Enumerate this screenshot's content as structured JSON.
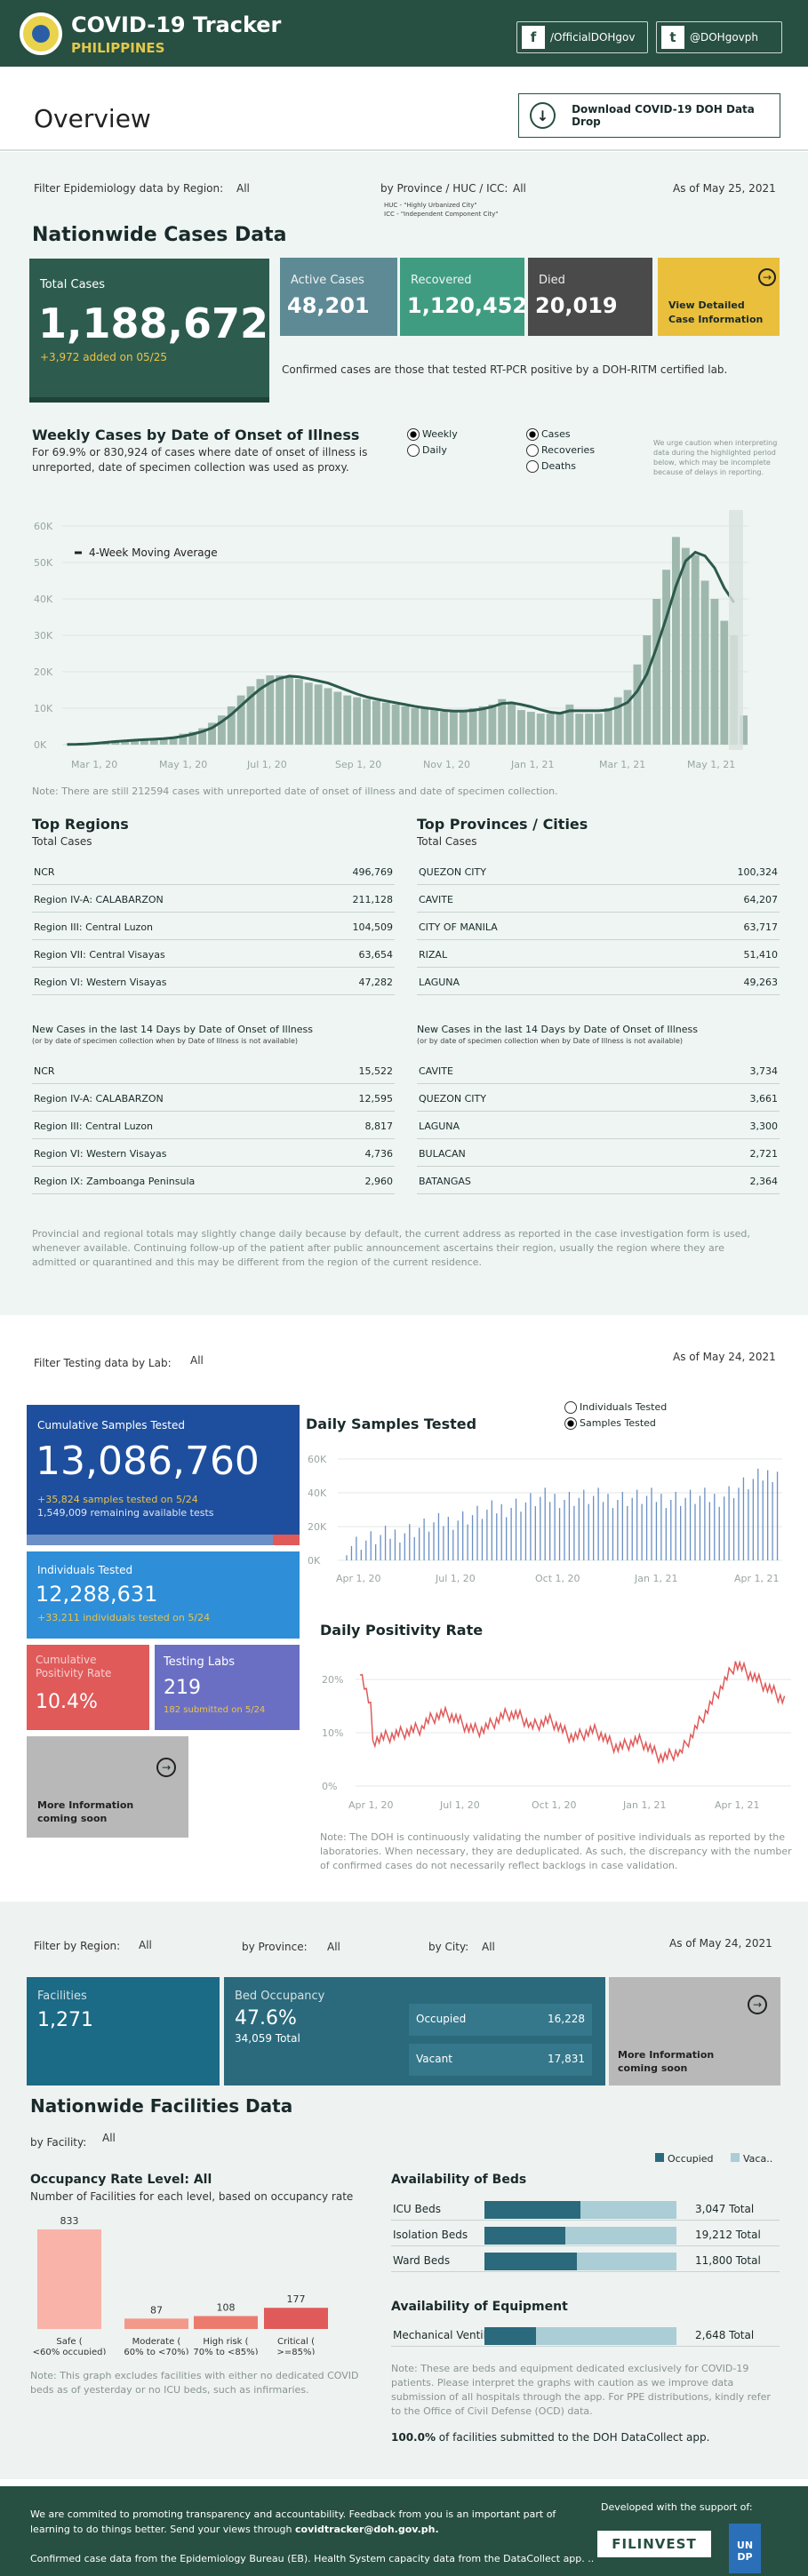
{
  "header": {
    "title": "COVID-19 Tracker",
    "subtitle": "PHILIPPINES",
    "facebook": "/OfficialDOHgov",
    "twitter": "@DOHgovph"
  },
  "overview": {
    "title": "Overview",
    "download_label": "Download COVID-19 DOH Data Drop"
  },
  "cases": {
    "filter_region_label": "Filter Epidemiology data by Region:",
    "filter_region_value": "All",
    "filter_province_label": "by Province / HUC / ICC:",
    "filter_province_value": "All",
    "huc_note": "HUC - \"Highly Urbanized City\"",
    "icc_note": "ICC - \"Independent Component City\"",
    "as_of": "As of May 25, 2021",
    "title": "Nationwide Cases Data",
    "total_label": "Total Cases",
    "total_value": "1,188,672",
    "total_added": "+3,972 added on 05/25",
    "active_label": "Active Cases",
    "active_value": "48,201",
    "recovered_label": "Recovered",
    "recovered_value": "1,120,452",
    "died_label": "Died",
    "died_value": "20,019",
    "view_detailed": "View Detailed Case Information",
    "confirmed_note": "Confirmed cases are those that tested RT-PCR positive by a DOH-RITM certified lab.",
    "weekly_title": "Weekly Cases by Date of Onset of Illness",
    "weekly_desc": "For 69.9% or 830,924 of cases where date of onset of illness is unreported, date of specimen collection was used as proxy.",
    "opt_weekly": "Weekly",
    "opt_daily": "Daily",
    "opt_cases": "Cases",
    "opt_recoveries": "Recoveries",
    "opt_deaths": "Deaths",
    "caution": "We urge caution when interpreting data during the highlighted period below, which may be incomplete because of delays in reporting.",
    "moving_avg": "4-Week Moving Average",
    "unreported_note": "Note: There are still 212594 cases with unreported date of onset of illness and date of specimen collection.",
    "top_regions": "Top Regions",
    "top_regions_sub": "Total Cases",
    "top_prov": "Top Provinces / Cities",
    "top_prov_sub": "Total Cases",
    "regions": [
      [
        "NCR",
        "496,769"
      ],
      [
        "Region IV-A: CALABARZON",
        "211,128"
      ],
      [
        "Region III: Central Luzon",
        "104,509"
      ],
      [
        "Region VII: Central Visayas",
        "63,654"
      ],
      [
        "Region VI: Western Visayas",
        "47,282"
      ]
    ],
    "provinces": [
      [
        "QUEZON CITY",
        "100,324"
      ],
      [
        "CAVITE",
        "64,207"
      ],
      [
        "CITY OF MANILA",
        "63,717"
      ],
      [
        "RIZAL",
        "51,410"
      ],
      [
        "LAGUNA",
        "49,263"
      ]
    ],
    "new14_title": "New Cases in the last 14 Days by Date of Onset of Illness",
    "new14_sub": "(or by date of specimen collection when by Date of Illness is not available)",
    "regions14": [
      [
        "NCR",
        "15,522"
      ],
      [
        "Region IV-A: CALABARZON",
        "12,595"
      ],
      [
        "Region III: Central Luzon",
        "8,817"
      ],
      [
        "Region VI: Western Visayas",
        "4,736"
      ],
      [
        "Region IX: Zamboanga Peninsula",
        "2,960"
      ]
    ],
    "provinces14": [
      [
        "CAVITE",
        "3,734"
      ],
      [
        "QUEZON CITY",
        "3,661"
      ],
      [
        "LAGUNA",
        "3,300"
      ],
      [
        "BULACAN",
        "2,721"
      ],
      [
        "BATANGAS",
        "2,364"
      ]
    ],
    "provincial_note": "Provincial and regional totals may slightly change daily because by default, the current address as reported in the case investigation form is used, whenever available. Continuing follow-up of the patient after public announcement ascertains their region, usually the region where they are admitted or quarantined and this may be different from the region of the current residence."
  },
  "testing": {
    "filter_label": "Filter Testing data by Lab:",
    "filter_value": "All",
    "as_of": "As of May 24, 2021",
    "cumulative_label": "Cumulative Samples Tested",
    "cumulative_value": "13,086,760",
    "cumulative_added": "+35,824 samples tested on 5/24",
    "cumulative_remaining": "1,549,009 remaining available tests",
    "individuals_label": "Individuals Tested",
    "individuals_value": "12,288,631",
    "individuals_added": "+33,211  individuals  tested on 5/24",
    "positivity_label": "Cumulative Positivity Rate",
    "positivity_value": "10.4%",
    "labs_label": "Testing Labs",
    "labs_value": "219",
    "labs_sub": "182 submitted on 5/24",
    "more_info": "More Information coming soon",
    "daily_title": "Daily Samples Tested",
    "opt_individuals": "Individuals Tested",
    "opt_samples": "Samples Tested",
    "positivity_title": "Daily Positivity Rate",
    "note": "Note: The DOH is continuously validating the number of positive individuals as reported by the laboratories. When necessary, they are deduplicated. As such, the discrepancy with the number of confirmed cases do not necessarily reflect backlogs in case validation."
  },
  "facilities": {
    "filter_region_label": "Filter by Region:",
    "filter_region_value": "All",
    "filter_province_label": "by Province:",
    "filter_province_value": "All",
    "filter_city_label": "by City:",
    "filter_city_value": "All",
    "as_of": "As of May 24, 2021",
    "facilities_label": "Facilities",
    "facilities_value": "1,271",
    "bed_label": "Bed Occupancy",
    "bed_value": "47.6%",
    "bed_total": "34,059 Total",
    "occupied_label": "Occupied",
    "occupied_value": "16,228",
    "vacant_label": "Vacant",
    "vacant_value": "17,831",
    "more_info": "More Information coming soon",
    "title": "Nationwide Facilities Data",
    "by_facility_label": "by Facility:",
    "by_facility_value": "All",
    "legend_occupied": "Occupied",
    "legend_vacant": "Vaca..",
    "occ_title": "Occupancy Rate Level:",
    "occ_title_value": "All",
    "occ_sub": "Number of Facilities for each level, based on occupancy rate",
    "occ_note": "Note: This graph excludes facilities with either no dedicated COVID beds as of yesterday or no ICU beds, such as infirmaries.",
    "beds_title": "Availability of Beds",
    "beds": [
      {
        "label": "ICU Beds",
        "total": "3,047 Total",
        "occ": 0.5
      },
      {
        "label": "Isolation Beds",
        "total": "19,212 Total",
        "occ": 0.42
      },
      {
        "label": "Ward Beds",
        "total": "11,800 Total",
        "occ": 0.48
      }
    ],
    "equip_title": "Availability of Equipment",
    "equip": [
      {
        "label": "Mechanical Ventilators",
        "total": "2,648 Total",
        "occ": 0.27
      }
    ],
    "beds_note": "Note: These are beds and equipment dedicated exclusively for COVID-19 patients. Please interpret the graphs with caution as we improve data submission of all hospitals through the app. For PPE distributions, kindly refer to the Office of Civil Defense (OCD) data.",
    "submitted": "100.0%",
    "submitted_rest": " of facilities submitted to the DOH DataCollect app."
  },
  "footer": {
    "text1": "We are commited to promoting transparency and accountability. Feedback from you is an important part of learning to do things better. Send your views through ",
    "email": "covidtracker@doh.gov.ph.",
    "support": "Developed with the support of:",
    "filinvest": "FILINVEST",
    "undp": "UN DP",
    "text2": "Confirmed case data from the Epidemiology Bureau (EB). Health System capacity data from the DataCollect app. .."
  },
  "colors": {
    "dark_green": "#274f42",
    "total_card": "#2d5c4f",
    "active": "#5e8a95",
    "recovered": "#3f9c80",
    "died": "#4a4a4a",
    "yellow": "#e9bf3c",
    "blue_dark": "#1e4f9e",
    "blue_mid": "#2e8ed8",
    "red": "#e05a5a",
    "purple": "#6b6fc4",
    "teal": "#1b6a86",
    "grey": "#b8b8b8"
  },
  "chart_data": [
    {
      "type": "bar",
      "title": "Weekly Cases by Date of Onset of Illness",
      "x_ticks": [
        "Mar 1, 20",
        "May 1, 20",
        "Jul 1, 20",
        "Sep 1, 20",
        "Nov 1, 20",
        "Jan 1, 21",
        "Mar 1, 21",
        "May 1, 21"
      ],
      "y_ticks": [
        "0K",
        "10K",
        "20K",
        "30K",
        "40K",
        "50K",
        "60K"
      ],
      "ylim": [
        0,
        60000
      ],
      "values": [
        50,
        100,
        200,
        400,
        700,
        1000,
        1200,
        1300,
        1400,
        1600,
        1800,
        2200,
        3000,
        3500,
        4500,
        6000,
        8000,
        10500,
        13500,
        16000,
        18000,
        19000,
        19000,
        18500,
        18000,
        17000,
        16500,
        15500,
        14500,
        13500,
        13000,
        12500,
        12000,
        11500,
        11000,
        10500,
        10000,
        10000,
        9500,
        9000,
        9000,
        9500,
        10000,
        10500,
        11000,
        12500,
        11500,
        9500,
        9000,
        8500,
        8500,
        8500,
        11000,
        8500,
        8500,
        8500,
        10000,
        13000,
        15000,
        22000,
        30000,
        40000,
        48000,
        57000,
        54000,
        52000,
        45000,
        40000,
        34000,
        30000,
        8000
      ],
      "moving_avg": [
        50,
        90,
        190,
        380,
        620,
        860,
        1050,
        1230,
        1370,
        1490,
        1650,
        1900,
        2300,
        2900,
        3600,
        4600,
        6300,
        8300,
        10700,
        13100,
        15300,
        17000,
        18200,
        18800,
        18600,
        18100,
        17500,
        16900,
        15900,
        14900,
        13900,
        13100,
        12500,
        12000,
        11500,
        11000,
        10500,
        10100,
        9800,
        9400,
        9200,
        9200,
        9400,
        9800,
        10400,
        11300,
        11500,
        11000,
        10400,
        9600,
        8900,
        8600,
        9300,
        9300,
        9300,
        9300,
        9500,
        10300,
        11600,
        14700,
        19400,
        26700,
        34800,
        43500,
        50400,
        52800,
        51800,
        48500,
        43000,
        39000
      ]
    },
    {
      "type": "bar",
      "title": "Daily Samples Tested",
      "x_ticks": [
        "Apr 1, 20",
        "Jul 1, 20",
        "Oct 1, 20",
        "Jan 1, 21",
        "Apr 1, 21"
      ],
      "y_ticks": [
        "0K",
        "20K",
        "40K",
        "60K"
      ],
      "ylim": [
        0,
        60000
      ]
    },
    {
      "type": "line",
      "title": "Daily Positivity Rate",
      "x_ticks": [
        "Apr 1, 20",
        "Jul 1, 20",
        "Oct 1, 20",
        "Jan 1, 21",
        "Apr 1, 21"
      ],
      "y_ticks": [
        "0%",
        "10%",
        "20%"
      ],
      "ylim": [
        0,
        25
      ]
    },
    {
      "type": "bar",
      "title": "Occupancy Rate Level",
      "categories": [
        "Safe (<60% occupied)",
        "Moderate (60% to <70%)",
        "High risk (70% to <85%)",
        "Critical (>=85%)"
      ],
      "values": [
        833,
        87,
        108,
        177
      ]
    }
  ]
}
